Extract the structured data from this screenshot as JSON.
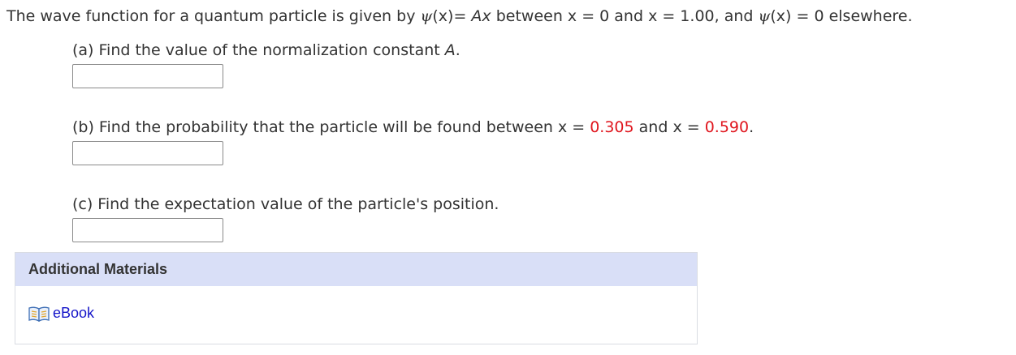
{
  "question": {
    "intro": {
      "t1": "The wave function for a quantum particle is given by ",
      "psi1": "ψ",
      "t2": "(x)= ",
      "Ax": "Ax",
      "t3": " between x = 0 and x = 1.00, and ",
      "psi2": "ψ",
      "t4": "(x) = 0 elsewhere."
    },
    "parts": {
      "a": {
        "t1": "(a) Find the value of the normalization constant ",
        "A": "A",
        "t2": ".",
        "answer_value": ""
      },
      "b": {
        "t1": "(b) Find the probability that the particle will be found between x = ",
        "x1": "0.305",
        "t2": " and x = ",
        "x2": "0.590",
        "t3": ".",
        "answer_value": ""
      },
      "c": {
        "text": "(c) Find the expectation value of the particle's position.",
        "answer_value": ""
      }
    }
  },
  "additional_materials": {
    "header": "Additional Materials",
    "ebook_label": "eBook",
    "ebook_icon": "book-icon"
  },
  "colors": {
    "highlight_red": "#e0161e",
    "link_blue": "#1515c9",
    "header_bg": "#d9dff7"
  }
}
